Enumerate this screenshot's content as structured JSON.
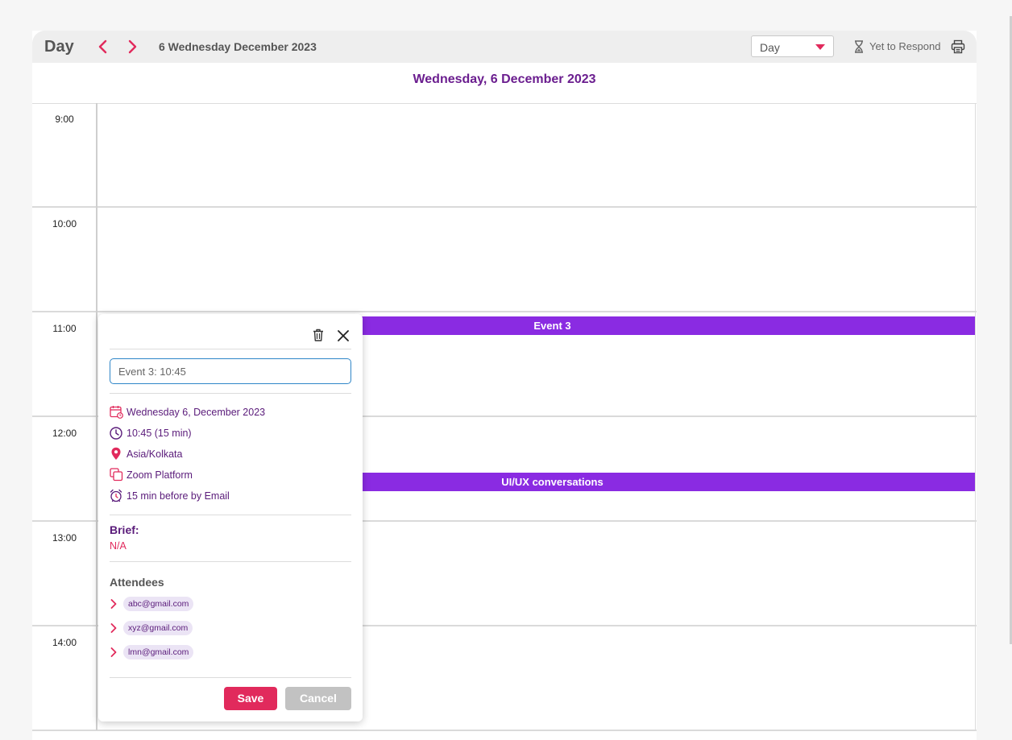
{
  "toolbar": {
    "view_title": "Day",
    "date_label": "6 Wednesday December 2023",
    "view_select": "Day",
    "respond_label": "Yet to Respond"
  },
  "day_header": "Wednesday, 6 December 2023",
  "hours": [
    "9:00",
    "10:00",
    "11:00",
    "12:00",
    "13:00",
    "14:00"
  ],
  "events": [
    {
      "title": "Event 3"
    },
    {
      "title": "UI/UX conversations"
    }
  ],
  "popup": {
    "title_value": "Event 3: 10:45",
    "date": "Wednesday 6, December 2023",
    "time": "10:45 (15 min)",
    "timezone": "Asia/Kolkata",
    "platform": "Zoom Platform",
    "reminder": "15 min before by Email",
    "brief_label": "Brief:",
    "brief_value": "N/A",
    "attendees_label": "Attendees",
    "attendees": [
      "abc@gmail.com",
      "xyz@gmail.com",
      "lmn@gmail.com"
    ],
    "save_label": "Save",
    "cancel_label": "Cancel"
  },
  "colors": {
    "accent": "#e12a5c",
    "event": "#8a2be2",
    "header_text": "#6b1e8f",
    "detail_text": "#5a1b7a"
  },
  "icons": [
    "chevron-left-icon",
    "chevron-right-icon",
    "hourglass-icon",
    "printer-icon",
    "trash-icon",
    "close-icon",
    "calendar-icon",
    "clock-icon",
    "location-pin-icon",
    "platform-icon",
    "alarm-icon",
    "chevron-right-icon"
  ]
}
